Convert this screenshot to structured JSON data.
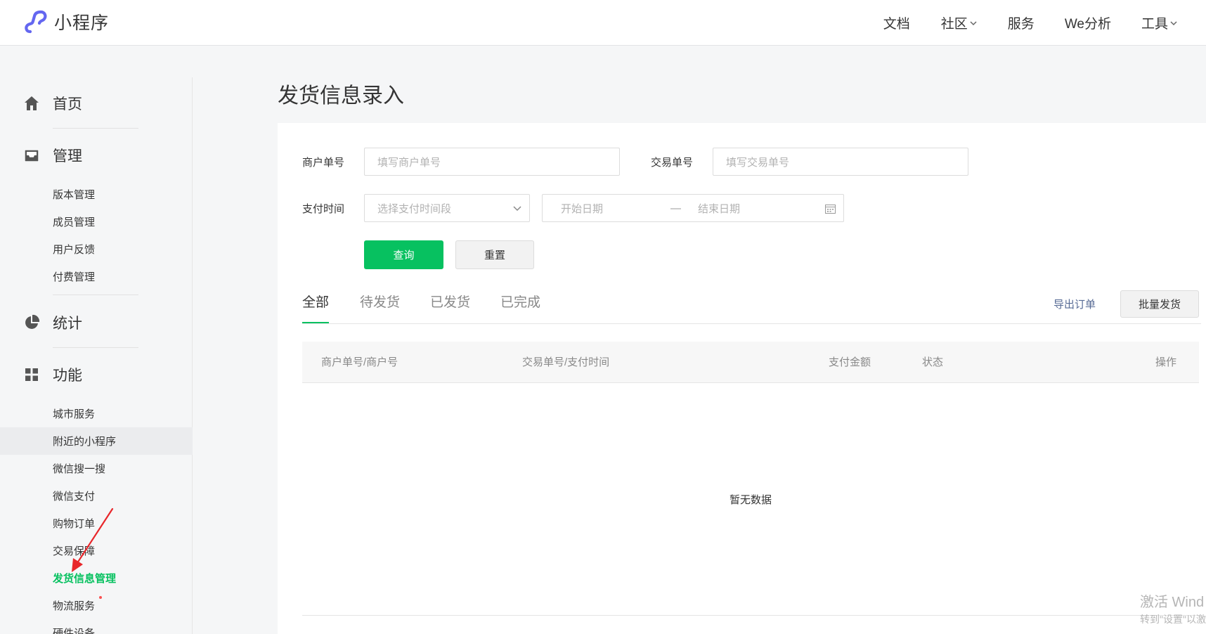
{
  "header": {
    "logo_text": "小程序",
    "nav": [
      {
        "label": "文档",
        "dropdown": false
      },
      {
        "label": "社区",
        "dropdown": true
      },
      {
        "label": "服务",
        "dropdown": false
      },
      {
        "label": "We分析",
        "dropdown": false
      },
      {
        "label": "工具",
        "dropdown": true
      }
    ]
  },
  "sidebar": {
    "sections": [
      {
        "label": "首页",
        "icon": "home-icon",
        "items": []
      },
      {
        "label": "管理",
        "icon": "inbox-icon",
        "items": [
          "版本管理",
          "成员管理",
          "用户反馈",
          "付费管理"
        ]
      },
      {
        "label": "统计",
        "icon": "pie-chart-icon",
        "items": []
      },
      {
        "label": "功能",
        "icon": "grid-icon",
        "items": [
          "城市服务",
          "附近的小程序",
          "微信搜一搜",
          "微信支付",
          "购物订单",
          "交易保障",
          "发货信息管理",
          "物流服务",
          "硬件设备"
        ]
      }
    ],
    "highlighted_item": "附近的小程序",
    "current_item": "发货信息管理"
  },
  "page": {
    "title": "发货信息录入",
    "filters": {
      "merchant_no": {
        "label": "商户单号",
        "placeholder": "填写商户单号"
      },
      "trade_no": {
        "label": "交易单号",
        "placeholder": "填写交易单号"
      },
      "pay_time": {
        "label": "支付时间",
        "select_placeholder": "选择支付时间段",
        "start_placeholder": "开始日期",
        "range_separator": "—",
        "end_placeholder": "结束日期"
      }
    },
    "buttons": {
      "query": "查询",
      "reset": "重置",
      "export": "导出订单",
      "batch_ship": "批量发货"
    },
    "tabs": [
      "全部",
      "待发货",
      "已发货",
      "已完成"
    ],
    "active_tab": "全部",
    "table": {
      "columns": [
        "商户单号/商户号",
        "交易单号/支付时间",
        "支付金额",
        "状态",
        "操作"
      ],
      "rows": [],
      "empty_text": "暂无数据"
    }
  },
  "watermark": {
    "line1": "激活 Wind",
    "line2": "转到\"设置\"以激"
  },
  "colors": {
    "primary_green": "#07c160",
    "link_blue": "#576b95",
    "annotation_red": "#e8262a"
  }
}
